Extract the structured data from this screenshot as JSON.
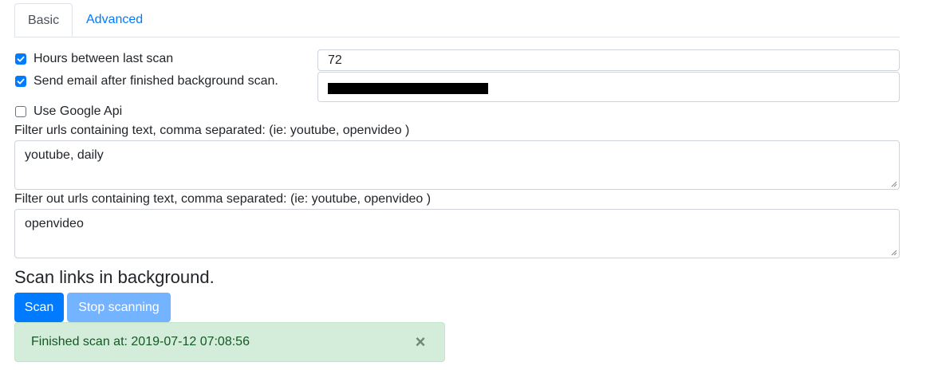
{
  "tabs": [
    {
      "label": "Basic",
      "active": true
    },
    {
      "label": "Advanced",
      "active": false
    }
  ],
  "options": {
    "hours_between_scan": {
      "label": "Hours between last scan",
      "checked": true,
      "value": "72"
    },
    "send_email": {
      "label": "Send email after finished background scan.",
      "checked": true,
      "value": "[redacted]"
    },
    "use_google_api": {
      "label": "Use Google Api",
      "checked": false
    }
  },
  "filter_include": {
    "label": "Filter urls containing text, comma separated: (ie: youtube, openvideo )",
    "value": "youtube, daily"
  },
  "filter_exclude": {
    "label": "Filter out urls containing text, comma separated: (ie: youtube, openvideo )",
    "value": "openvideo"
  },
  "section_title": "Scan links in background.",
  "buttons": {
    "scan": "Scan",
    "stop": "Stop scanning"
  },
  "alert": {
    "message": "Finished scan at: 2019-07-12 07:08:56",
    "close_glyph": "×"
  },
  "colors": {
    "primary": "#007bff",
    "primary_disabled": "#74b3ff",
    "success_bg": "#d4edda",
    "success_text": "#155724"
  }
}
